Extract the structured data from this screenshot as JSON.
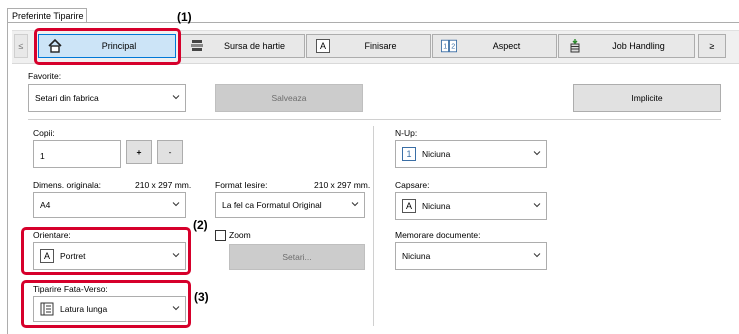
{
  "tab": {
    "label": "Preferinte Tiparire"
  },
  "toolbar": {
    "left_scroll": "≤",
    "right_scroll": "≥",
    "buttons": [
      {
        "label": "Principal",
        "icon": "home-icon",
        "active": true
      },
      {
        "label": "Sursa de hartie",
        "icon": "paper-tray-icon"
      },
      {
        "label": "Finisare",
        "icon": "finishing-icon",
        "glyph": "A"
      },
      {
        "label": "Aspect",
        "icon": "layout-icon",
        "glyph": "1|2"
      },
      {
        "label": "Job Handling",
        "icon": "job-handling-icon"
      }
    ]
  },
  "favorites": {
    "label": "Favorite:",
    "value": "Setari din fabrica",
    "save_label": "Salveaza",
    "defaults_label": "Implicite"
  },
  "copies": {
    "label": "Copii:",
    "value": "1",
    "plus": "+",
    "minus": "-"
  },
  "original_size": {
    "label": "Dimens. originala:",
    "size": "210 x 297 mm.",
    "value": "A4"
  },
  "output_format": {
    "label": "Format Iesire:",
    "size": "210 x 297 mm.",
    "value": "La fel ca Formatul Original"
  },
  "orientation": {
    "label": "Orientare:",
    "value": "Portret",
    "glyph": "A"
  },
  "zoom": {
    "label": "Zoom",
    "settings_label": "Setari..."
  },
  "duplex": {
    "label": "Tiparire Fata-Verso:",
    "value": "Latura lunga"
  },
  "nup": {
    "label": "N-Up:",
    "value": "Niciuna",
    "glyph": "1"
  },
  "cover": {
    "label": "Capsare:",
    "value": "Niciuna",
    "glyph": "A"
  },
  "doc_filing": {
    "label": "Memorare documente:",
    "value": "Niciuna"
  },
  "callouts": {
    "c1": "(1)",
    "c2": "(2)",
    "c3": "(3)"
  },
  "colors": {
    "highlight": "#d6002b",
    "active_tab_bg": "#cce4f7",
    "active_tab_border": "#0078d7"
  }
}
